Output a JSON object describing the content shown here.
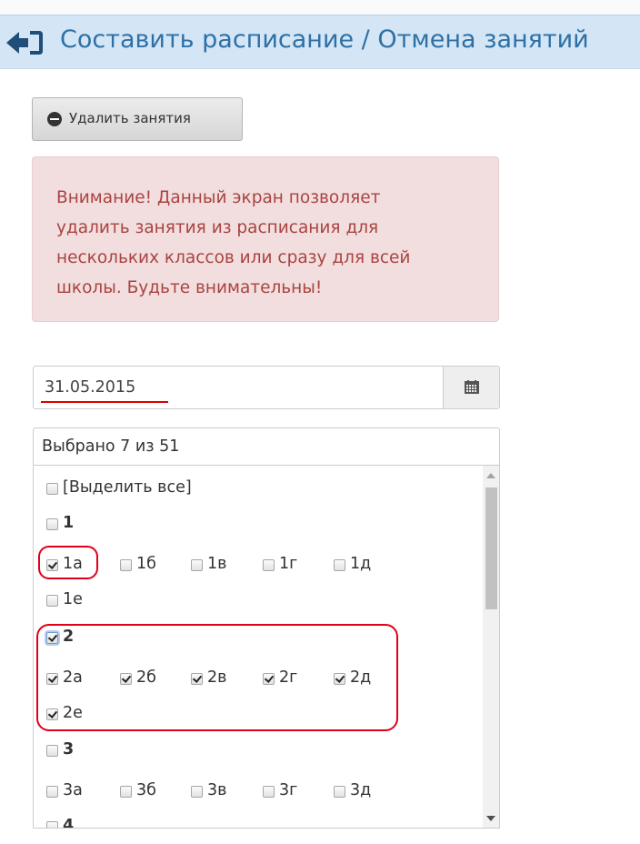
{
  "header": {
    "title": "Составить расписание / Отмена занятий",
    "back_icon": "arrow-left-icon"
  },
  "toolbar": {
    "delete_label": "Удалить занятия",
    "delete_icon": "minus-circle-icon"
  },
  "alert": {
    "text": "Внимание! Данный экран позволяет удалить занятия из расписания для нескольких классов или сразу для всей школы. Будьте внимательны!"
  },
  "date": {
    "value": "31.05.2015",
    "icon": "calendar-icon"
  },
  "multiselect": {
    "summary": "Выбрано 7 из 51"
  },
  "classes": {
    "select_all": {
      "label": "[Выделить все]",
      "checked": false
    },
    "g1": {
      "label": "1",
      "checked": false
    },
    "c1a": {
      "label": "1а",
      "checked": true
    },
    "c1b": {
      "label": "1б",
      "checked": false
    },
    "c1v": {
      "label": "1в",
      "checked": false
    },
    "c1g": {
      "label": "1г",
      "checked": false
    },
    "c1d": {
      "label": "1д",
      "checked": false
    },
    "c1e": {
      "label": "1е",
      "checked": false
    },
    "g2": {
      "label": "2",
      "checked": true
    },
    "c2a": {
      "label": "2а",
      "checked": true
    },
    "c2b": {
      "label": "2б",
      "checked": true
    },
    "c2v": {
      "label": "2в",
      "checked": true
    },
    "c2g": {
      "label": "2г",
      "checked": true
    },
    "c2d": {
      "label": "2д",
      "checked": true
    },
    "c2e": {
      "label": "2е",
      "checked": true
    },
    "g3": {
      "label": "3",
      "checked": false
    },
    "c3a": {
      "label": "3а",
      "checked": false
    },
    "c3b": {
      "label": "3б",
      "checked": false
    },
    "c3v": {
      "label": "3в",
      "checked": false
    },
    "c3g": {
      "label": "3г",
      "checked": false
    },
    "c3d": {
      "label": "3д",
      "checked": false
    },
    "g4": {
      "label": "4",
      "checked": false
    }
  },
  "colors": {
    "header_bg": "#d4e6f5",
    "title": "#2e70a6",
    "alert_bg": "#f2dede",
    "alert_text": "#a94442",
    "annotation": "#e0001a"
  }
}
